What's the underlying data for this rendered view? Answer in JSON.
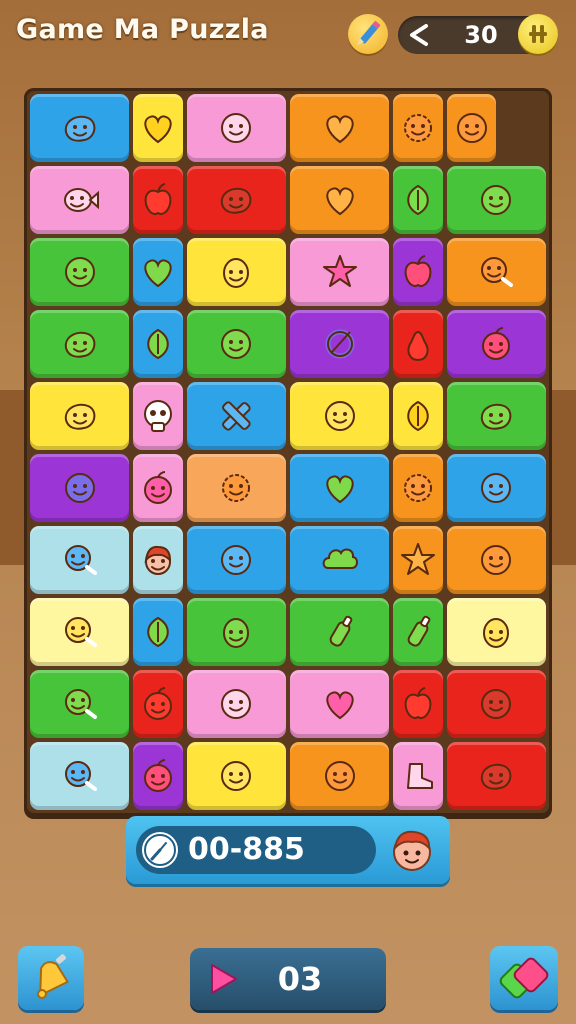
{
  "header": {
    "title": "Game Ma Puzzla",
    "pencil_icon": "pencil-icon",
    "share_icon": "share-icon",
    "score": "30",
    "coin_icon": "coin-icon"
  },
  "timer": {
    "clock_icon": "clock-icon",
    "value": "00-885",
    "avatar_icon": "character-face-icon"
  },
  "footer": {
    "bell_icon": "bell-icon",
    "play_icon": "play-icon",
    "level": "03",
    "gems_icon": "gems-icon"
  },
  "colors": {
    "red": "#e8241c",
    "blue": "#2ea3e8",
    "pink": "#f79ad6",
    "orange": "#f7941d",
    "yellow": "#ffe53b",
    "green": "#48c43b",
    "purple": "#9b35d6",
    "lightblue": "#aee0ea",
    "paleyellow": "#fff7a0",
    "lightorange": "#f7a65a"
  },
  "board": {
    "rows": [
      [
        [
          "blue",
          "blob-face",
          2
        ],
        [
          "yellow",
          "heart",
          1
        ],
        [
          "pink",
          "smiley",
          2
        ],
        [
          "orange",
          "heart",
          2
        ],
        [
          "orange",
          "sun-face",
          1
        ],
        [
          "orange",
          "smiley",
          1
        ]
      ],
      [
        [
          "pink",
          "fish-face",
          2
        ],
        [
          "red",
          "apple",
          1
        ],
        [
          "red",
          "blob-face",
          2
        ],
        [
          "orange",
          "heart",
          2
        ],
        [
          "green",
          "leaf",
          1
        ],
        [
          "green",
          "smiley",
          2
        ]
      ],
      [
        [
          "green",
          "smiley",
          2
        ],
        [
          "blue",
          "heart",
          1
        ],
        [
          "yellow",
          "egg-face",
          2
        ],
        [
          "pink",
          "star",
          2
        ],
        [
          "purple",
          "apple",
          1
        ],
        [
          "orange",
          "lollipop",
          2
        ]
      ],
      [
        [
          "green",
          "blob-face",
          2
        ],
        [
          "blue",
          "leaf",
          1
        ],
        [
          "green",
          "smiley",
          2
        ],
        [
          "purple",
          "ring",
          2
        ],
        [
          "red",
          "pear",
          1
        ],
        [
          "purple",
          "fruit",
          2
        ]
      ],
      [
        [
          "yellow",
          "blob-face",
          2
        ],
        [
          "pink",
          "skull",
          1
        ],
        [
          "blue",
          "cross",
          2
        ],
        [
          "yellow",
          "smiley",
          2
        ],
        [
          "yellow",
          "leaf",
          1
        ],
        [
          "green",
          "blob-face",
          2
        ]
      ],
      [
        [
          "purple",
          "smiley",
          2
        ],
        [
          "pink",
          "fruit",
          1
        ],
        [
          "lightorange",
          "sun-face",
          2
        ],
        [
          "blue",
          "heart",
          2
        ],
        [
          "orange",
          "sun-face",
          1
        ],
        [
          "blue",
          "smiley",
          2
        ]
      ],
      [
        [
          "lightblue",
          "lollipop",
          2
        ],
        [
          "lightblue",
          "kid-face",
          1
        ],
        [
          "blue",
          "smiley",
          2
        ],
        [
          "blue",
          "cloud",
          2
        ],
        [
          "orange",
          "star",
          1
        ],
        [
          "orange",
          "smiley",
          2
        ]
      ],
      [
        [
          "paleyellow",
          "lollipop",
          2
        ],
        [
          "blue",
          "leaf",
          1
        ],
        [
          "green",
          "egg-face",
          2
        ],
        [
          "green",
          "bottle",
          2
        ],
        [
          "green",
          "bottle",
          1
        ],
        [
          "paleyellow",
          "egg-face",
          2
        ]
      ],
      [
        [
          "green",
          "lollipop",
          2
        ],
        [
          "red",
          "fruit",
          1
        ],
        [
          "pink",
          "smiley",
          2
        ],
        [
          "pink",
          "heart",
          2
        ],
        [
          "red",
          "apple",
          1
        ],
        [
          "red",
          "smiley",
          2
        ]
      ],
      [
        [
          "lightblue",
          "lollipop",
          2
        ],
        [
          "purple",
          "fruit",
          1
        ],
        [
          "yellow",
          "smiley",
          2
        ],
        [
          "orange",
          "smiley",
          2
        ],
        [
          "pink",
          "boot",
          1
        ],
        [
          "red",
          "blob-face",
          2
        ]
      ]
    ]
  }
}
